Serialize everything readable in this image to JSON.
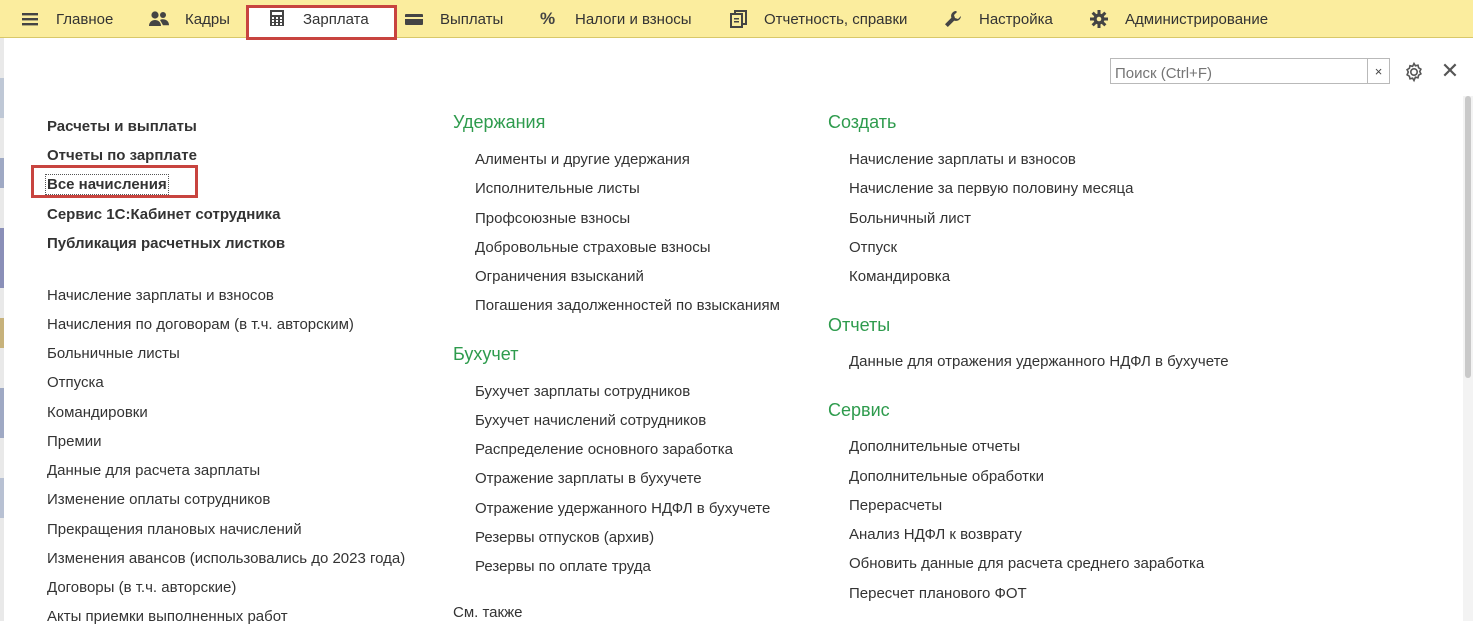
{
  "nav": {
    "items": [
      {
        "label": "Главное",
        "icon": "menu-icon"
      },
      {
        "label": "Кадры",
        "icon": "people-icon"
      },
      {
        "label": "Зарплата",
        "icon": "calculator-icon"
      },
      {
        "label": "Выплаты",
        "icon": "card-icon"
      },
      {
        "label": "Налоги и взносы",
        "icon": "percent-icon"
      },
      {
        "label": "Отчетность, справки",
        "icon": "documents-icon"
      },
      {
        "label": "Настройка",
        "icon": "wrench-icon"
      },
      {
        "label": "Администрирование",
        "icon": "gear-icon"
      }
    ],
    "active": "Зарплата"
  },
  "search": {
    "placeholder": "Поиск (Ctrl+F)",
    "clear": "×"
  },
  "close_symbol": "✕",
  "left": {
    "bold_items": [
      "Расчеты и выплаты",
      "Отчеты по зарплате",
      "Все начисления",
      "Сервис 1С:Кабинет сотрудника",
      "Публикация расчетных листков"
    ],
    "items": [
      "Начисление зарплаты и взносов",
      "Начисления по договорам (в т.ч. авторским)",
      "Больничные листы",
      "Отпуска",
      "Командировки",
      "Премии",
      "Данные для расчета зарплаты",
      "Изменение оплаты сотрудников",
      "Прекращения плановых начислений",
      "Изменения авансов (использовались до 2023 года)",
      "Договоры (в т.ч. авторские)",
      "Акты приемки выполненных работ"
    ]
  },
  "middle": {
    "sections": [
      {
        "title": "Удержания",
        "items": [
          "Алименты и другие удержания",
          "Исполнительные листы",
          "Профсоюзные взносы",
          "Добровольные страховые взносы",
          "Ограничения взысканий",
          "Погашения задолженностей по взысканиям"
        ]
      },
      {
        "title": "Бухучет",
        "items": [
          "Бухучет зарплаты сотрудников",
          "Бухучет начислений сотрудников",
          "Распределение основного заработка",
          "Отражение зарплаты в бухучете",
          "Отражение удержанного НДФЛ в бухучете",
          "Резервы отпусков (архив)",
          "Резервы по оплате труда"
        ]
      }
    ],
    "see_also": "См. также"
  },
  "right": {
    "sections": [
      {
        "title": "Создать",
        "items": [
          "Начисление зарплаты и взносов",
          "Начисление за первую половину месяца",
          "Больничный лист",
          "Отпуск",
          "Командировка"
        ]
      },
      {
        "title": "Отчеты",
        "items": [
          "Данные для отражения удержанного НДФЛ в бухучете"
        ]
      },
      {
        "title": "Сервис",
        "items": [
          "Дополнительные отчеты",
          "Дополнительные обработки",
          "Перерасчеты",
          "Анализ НДФЛ к возврату",
          "Обновить данные для расчета среднего заработка",
          "Пересчет планового ФОТ"
        ]
      }
    ]
  },
  "colors": {
    "topbar": "#fbed9e",
    "section_title": "#2e9b4d",
    "highlight": "#c8443f"
  }
}
